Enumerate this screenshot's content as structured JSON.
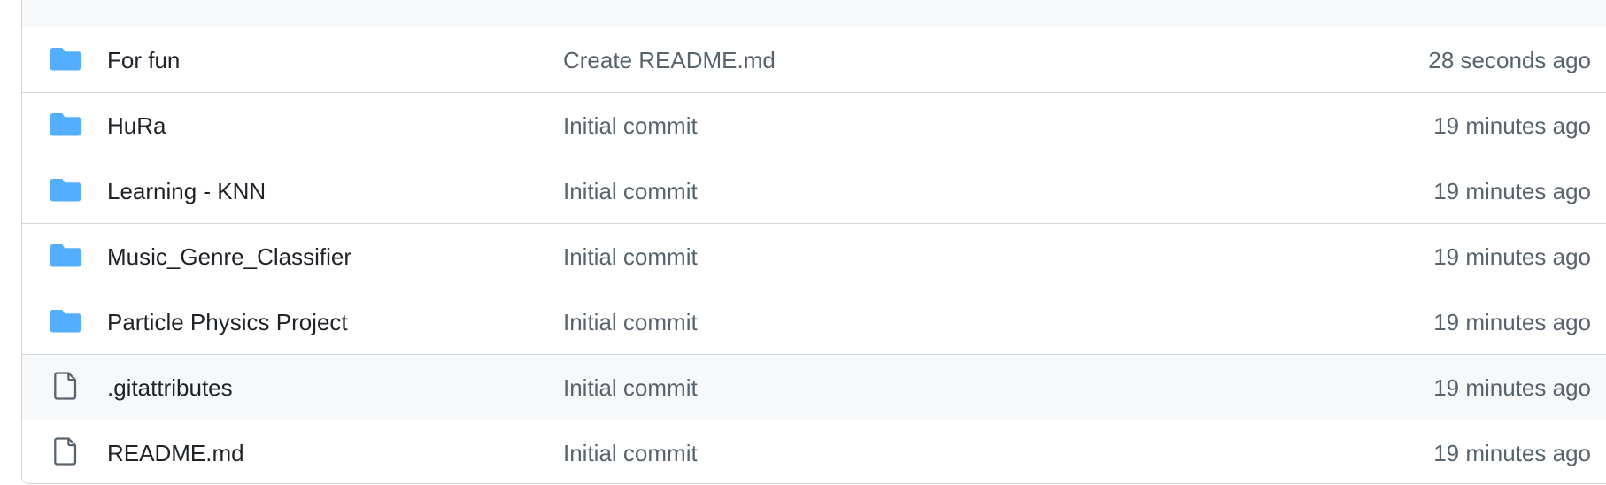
{
  "colors": {
    "folder_icon": "#54aeff",
    "file_icon": "#59636e",
    "name_text": "#1f2328",
    "muted_text": "#59636e",
    "border": "#d0d7de",
    "row_alt_bg": "#f6f8fa"
  },
  "files": [
    {
      "icon": "folder-icon",
      "name": "For fun",
      "commit": "Create README.md",
      "age": "28 seconds ago"
    },
    {
      "icon": "folder-icon",
      "name": "HuRa",
      "commit": "Initial commit",
      "age": "19 minutes ago"
    },
    {
      "icon": "folder-icon",
      "name": "Learning - KNN",
      "commit": "Initial commit",
      "age": "19 minutes ago"
    },
    {
      "icon": "folder-icon",
      "name": "Music_Genre_Classifier",
      "commit": "Initial commit",
      "age": "19 minutes ago"
    },
    {
      "icon": "folder-icon",
      "name": "Particle Physics Project",
      "commit": "Initial commit",
      "age": "19 minutes ago"
    },
    {
      "icon": "file-icon",
      "name": ".gitattributes",
      "commit": "Initial commit",
      "age": "19 minutes ago"
    },
    {
      "icon": "file-icon",
      "name": "README.md",
      "commit": "Initial commit",
      "age": "19 minutes ago"
    }
  ]
}
